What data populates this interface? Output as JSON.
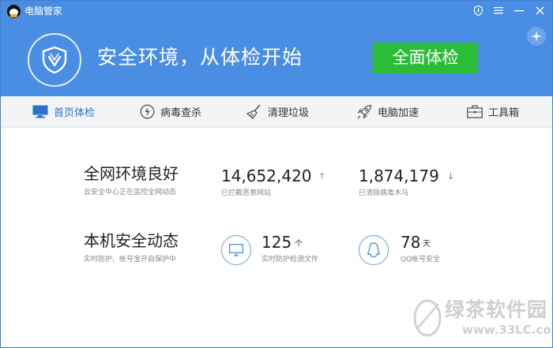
{
  "titlebar": {
    "app_title": "电脑管家"
  },
  "header": {
    "headline": "安全环境，从体检开始",
    "checkup_button": "全面体检"
  },
  "nav": {
    "items": [
      {
        "label": "首页体检",
        "icon": "monitor-icon",
        "active": true
      },
      {
        "label": "病毒查杀",
        "icon": "lightning-icon",
        "active": false
      },
      {
        "label": "清理垃圾",
        "icon": "broom-icon",
        "active": false
      },
      {
        "label": "电脑加速",
        "icon": "rocket-icon",
        "active": false
      },
      {
        "label": "工具箱",
        "icon": "toolbox-icon",
        "active": false
      }
    ]
  },
  "network": {
    "title": "全网环境良好",
    "subtitle": "云安全中心正在监控全网动态",
    "blocked_sites": {
      "value": "14,652,420",
      "arrow": "↑",
      "label": "已拦截恶意网站"
    },
    "cleared_trojans": {
      "value": "1,874,179",
      "arrow": "↓",
      "label": "已清除病毒木马"
    }
  },
  "local": {
    "title": "本机安全动态",
    "subtitle": "实时防护、帐号宝开启保护中",
    "realtime_files": {
      "value": "125",
      "unit": "个",
      "label": "实时防护检测文件"
    },
    "qq_days": {
      "value": "78",
      "unit": "天",
      "label": "QQ帐号安全"
    }
  },
  "watermark": {
    "text": "绿茶软件园",
    "url": "www.33LC.com"
  },
  "colors": {
    "header_blue": "#4a8ee3",
    "checkup_green": "#2bbd3a",
    "active_blue": "#2b73c9",
    "up_arrow": "#e07a3a",
    "down_arrow": "#3aa85a"
  }
}
